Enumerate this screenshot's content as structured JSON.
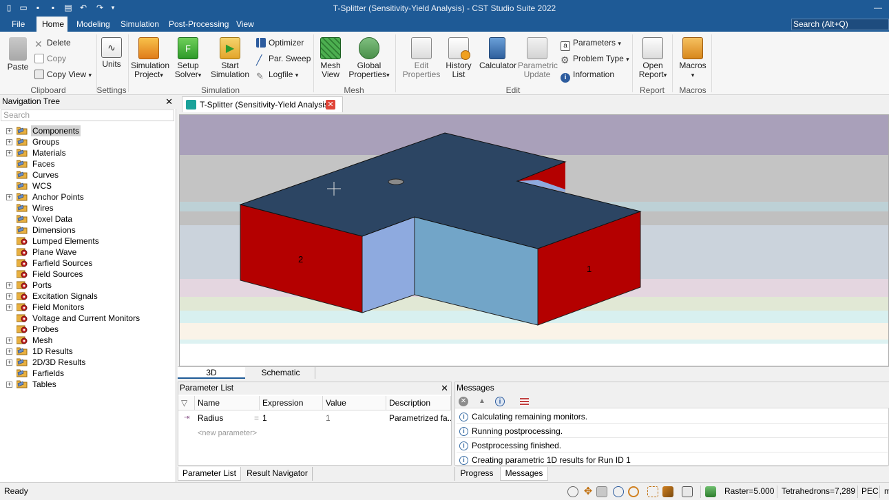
{
  "app": {
    "title": "T-Splitter (Sensitivity-Yield Analysis) - CST Studio Suite 2022"
  },
  "quick_access": [
    "new-icon",
    "open-icon",
    "save-icon",
    "save-all-icon",
    "print-icon",
    "undo-icon",
    "redo-icon",
    "customize-icon"
  ],
  "menu": {
    "items": [
      "File",
      "Home",
      "Modeling",
      "Simulation",
      "Post-Processing",
      "View"
    ],
    "active": "Home",
    "search_placeholder": "Search (Alt+Q)"
  },
  "ribbon": {
    "clipboard": {
      "paste": "Paste",
      "delete": "Delete",
      "copy": "Copy",
      "copy_view": "Copy View",
      "label": "Clipboard"
    },
    "settings": {
      "units": "Units",
      "label": "Settings"
    },
    "simulation": {
      "simulation_project_1": "Simulation",
      "simulation_project_2": "Project",
      "setup_solver_1": "Setup",
      "setup_solver_2": "Solver",
      "start_simulation_1": "Start",
      "start_simulation_2": "Simulation",
      "optimizer": "Optimizer",
      "par_sweep": "Par. Sweep",
      "logfile": "Logfile",
      "label": "Simulation"
    },
    "mesh": {
      "mesh_view_1": "Mesh",
      "mesh_view_2": "View",
      "global_properties_1": "Global",
      "global_properties_2": "Properties",
      "label": "Mesh"
    },
    "edit": {
      "edit_properties_1": "Edit",
      "edit_properties_2": "Properties",
      "history_list_1": "History",
      "history_list_2": "List",
      "calculator": "Calculator",
      "parametric_update_1": "Parametric",
      "parametric_update_2": "Update",
      "parameters": "Parameters",
      "problem_type": "Problem Type",
      "information": "Information",
      "label": "Edit"
    },
    "report": {
      "open_report_1": "Open",
      "open_report_2": "Report",
      "label": "Report"
    },
    "macros": {
      "macros": "Macros",
      "label": "Macros"
    }
  },
  "nav_tree": {
    "title": "Navigation Tree",
    "search_placeholder": "Search",
    "items": [
      {
        "label": "Components",
        "expandable": true,
        "selected": true,
        "icon": "folder"
      },
      {
        "label": "Groups",
        "expandable": true,
        "icon": "folder"
      },
      {
        "label": "Materials",
        "expandable": true,
        "icon": "folder"
      },
      {
        "label": "Faces",
        "expandable": false,
        "icon": "folder"
      },
      {
        "label": "Curves",
        "expandable": false,
        "icon": "folder"
      },
      {
        "label": "WCS",
        "expandable": false,
        "icon": "folder"
      },
      {
        "label": "Anchor Points",
        "expandable": true,
        "icon": "folder"
      },
      {
        "label": "Wires",
        "expandable": false,
        "icon": "folder"
      },
      {
        "label": "Voxel Data",
        "expandable": false,
        "icon": "folder"
      },
      {
        "label": "Dimensions",
        "expandable": false,
        "icon": "folder"
      },
      {
        "label": "Lumped Elements",
        "expandable": false,
        "icon": "gear-folder"
      },
      {
        "label": "Plane Wave",
        "expandable": false,
        "icon": "gear-folder"
      },
      {
        "label": "Farfield Sources",
        "expandable": false,
        "icon": "gear-folder"
      },
      {
        "label": "Field Sources",
        "expandable": false,
        "icon": "gear-folder"
      },
      {
        "label": "Ports",
        "expandable": true,
        "icon": "gear-folder"
      },
      {
        "label": "Excitation Signals",
        "expandable": true,
        "icon": "gear-folder"
      },
      {
        "label": "Field Monitors",
        "expandable": true,
        "icon": "gear-folder"
      },
      {
        "label": "Voltage and Current Monitors",
        "expandable": false,
        "icon": "gear-folder"
      },
      {
        "label": "Probes",
        "expandable": false,
        "icon": "gear-folder"
      },
      {
        "label": "Mesh",
        "expandable": true,
        "icon": "gear-folder"
      },
      {
        "label": "1D Results",
        "expandable": true,
        "icon": "folder"
      },
      {
        "label": "2D/3D Results",
        "expandable": true,
        "icon": "folder"
      },
      {
        "label": "Farfields",
        "expandable": false,
        "icon": "folder"
      },
      {
        "label": "Tables",
        "expandable": true,
        "icon": "folder"
      }
    ]
  },
  "document_tab": {
    "title": "T-Splitter (Sensitivity-Yield Analysis)*"
  },
  "viewport": {
    "port_labels": [
      "2",
      "1"
    ],
    "view_tabs": [
      "3D",
      "Schematic"
    ],
    "active_view_tab": "3D"
  },
  "parameter_list": {
    "title": "Parameter List",
    "columns": [
      "Name",
      "Expression",
      "Value",
      "Description"
    ],
    "rows": [
      {
        "name": "Radius",
        "eq": "=",
        "expression": "1",
        "value": "1",
        "description": "Parametrized fa..."
      }
    ],
    "new_parameter": "<new parameter>"
  },
  "messages": {
    "title": "Messages",
    "items": [
      "Calculating remaining monitors.",
      "Running postprocessing.",
      "Postprocessing finished.",
      "Creating parametric 1D results for Run ID 1"
    ]
  },
  "bottom_tabs": {
    "left": [
      "Parameter List",
      "Result Navigator"
    ],
    "left_active": "Parameter List",
    "right": [
      "Progress",
      "Messages"
    ],
    "right_active": "Messages"
  },
  "status_bar": {
    "ready": "Ready",
    "raster": "Raster=5.000",
    "tetrahedrons": "Tetrahedrons=7,289",
    "boundary": "PEC",
    "overflow": "m"
  },
  "colors": {
    "title_bar": "#1e5a96",
    "port_face": "#b40000",
    "top_face": "#2c4563",
    "side_face_light": "#72a5c8",
    "side_face_lighter": "#8eaadf"
  }
}
